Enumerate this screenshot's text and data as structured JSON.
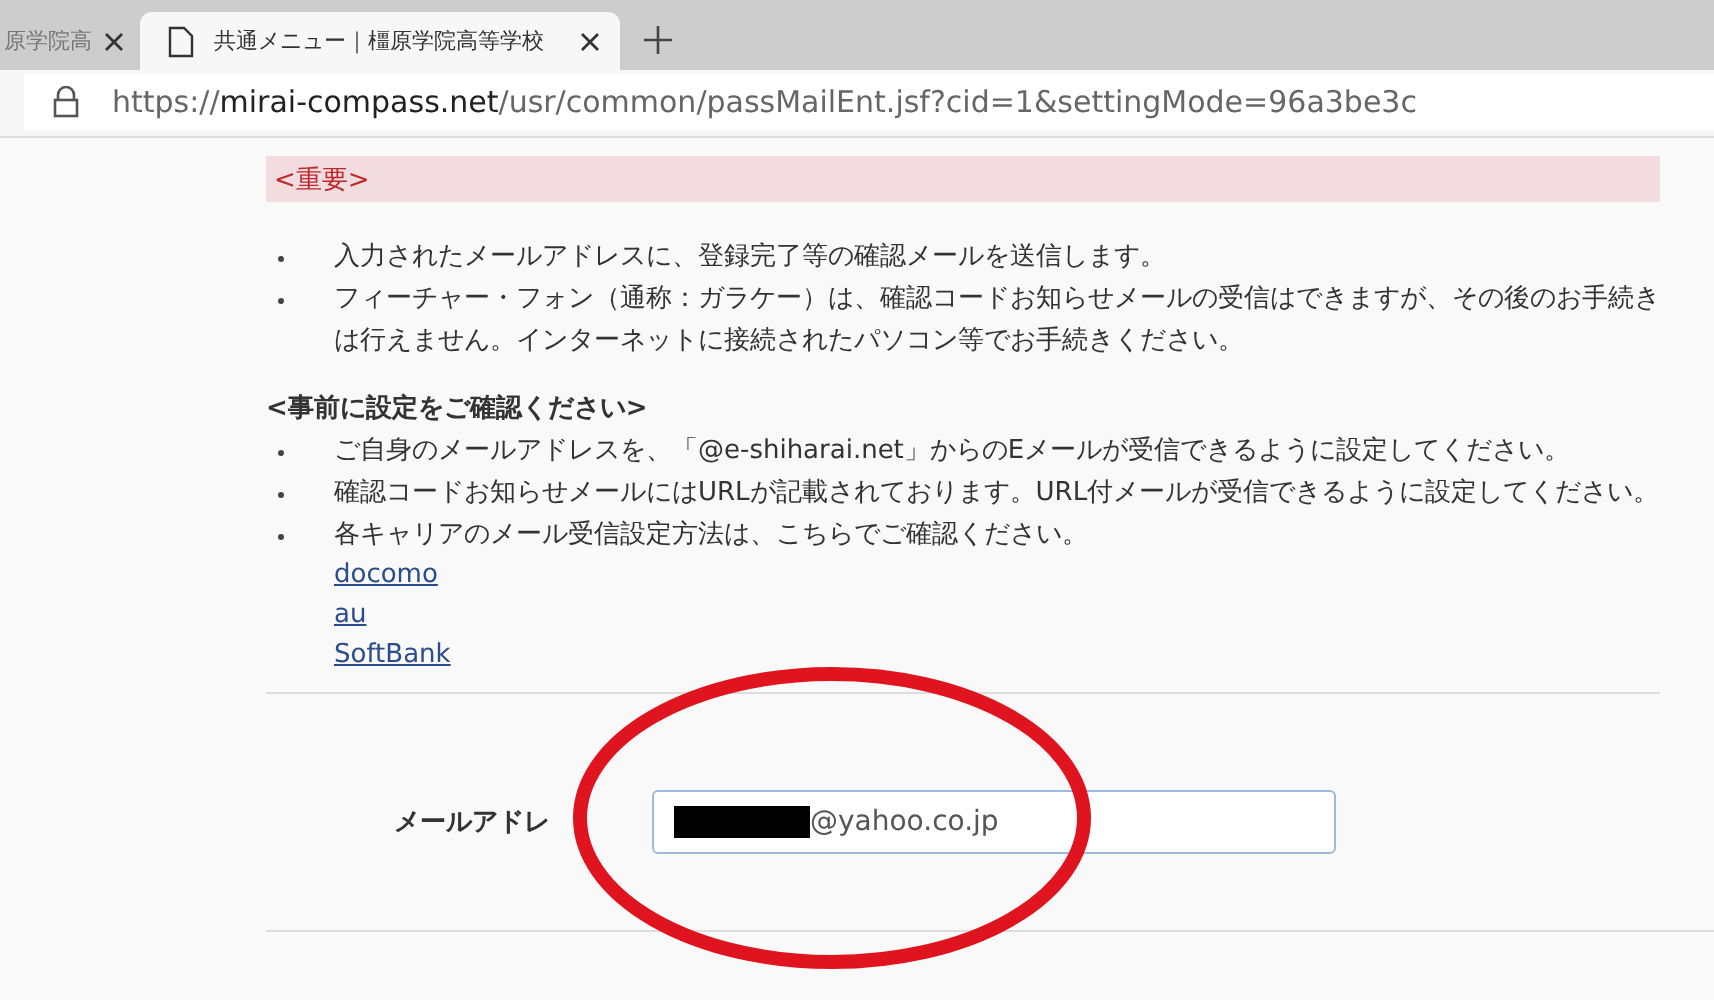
{
  "browser": {
    "tabs": [
      {
        "title": "原学院高",
        "selected": false
      },
      {
        "title": "共通メニュー｜橿原学院高等学校",
        "selected": true
      }
    ],
    "url": {
      "scheme": "https://",
      "host": "mirai-compass.net",
      "path": "/usr/common/passMailEnt.jsf?cid=1&settingMode=96a3be3c"
    }
  },
  "notice": {
    "title": "<重要>",
    "items": [
      "入力されたメールアドレスに、登録完了等の確認メールを送信します。",
      "フィーチャー・フォン（通称：ガラケー）は、確認コードお知らせメールの受信はできますが、その後のお手続きは行えません。インターネットに接続されたパソコン等でお手続きください。"
    ]
  },
  "settings": {
    "heading": "<事前に設定をご確認ください>",
    "items": [
      "ご自身のメールアドレスを、「@e-shiharai.net」からのEメールが受信できるように設定してください。",
      "確認コードお知らせメールにはURLが記載されております。URL付メールが受信できるように設定してください。",
      "各キャリアのメール受信設定方法は、こちらでご確認ください。"
    ],
    "links": [
      "docomo",
      "au",
      "SoftBank"
    ]
  },
  "form": {
    "label": "メールアドレ",
    "value": "@yahoo.co.jp",
    "redacted": true,
    "circled": true
  }
}
